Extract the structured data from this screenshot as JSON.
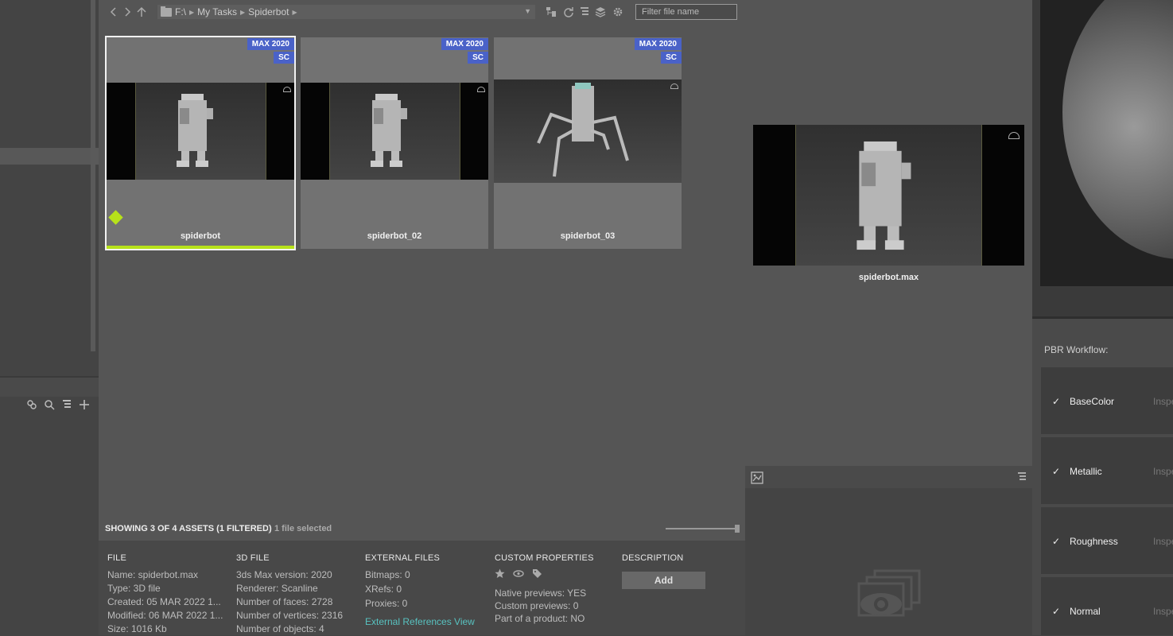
{
  "toolbar": {
    "path": [
      "F:\\",
      "My Tasks",
      "Spiderbot"
    ],
    "filter_placeholder": "Filter file name"
  },
  "assets": [
    {
      "name": "spiderbot",
      "badges": [
        "MAX 2020",
        "SC"
      ],
      "selected": true
    },
    {
      "name": "spiderbot_02",
      "badges": [
        "MAX 2020",
        "SC"
      ],
      "selected": false
    },
    {
      "name": "spiderbot_03",
      "badges": [
        "MAX 2020",
        "SC"
      ],
      "selected": false
    }
  ],
  "status": {
    "showing": "SHOWING 3 OF 4 ASSETS (1 FILTERED)",
    "selected": "1 file selected"
  },
  "info": {
    "file": {
      "header": "FILE",
      "rows": [
        "Name: spiderbot.max",
        "Type: 3D file",
        "Created: 05 MAR 2022 1...",
        "Modified: 06 MAR 2022 1...",
        "Size: 1016 Kb"
      ]
    },
    "file3d": {
      "header": "3D FILE",
      "rows": [
        "3ds Max version: 2020",
        "Renderer: Scanline",
        "Number of faces: 2728",
        "Number of vertices: 2316",
        "Number of objects: 4"
      ]
    },
    "external": {
      "header": "EXTERNAL FILES",
      "rows": [
        "Bitmaps: 0",
        "XRefs: 0",
        "Proxies: 0"
      ],
      "link": "External References View"
    },
    "custom": {
      "header": "CUSTOM PROPERTIES",
      "rows": [
        "Native previews: YES",
        "Custom previews: 0",
        "Part of a product: NO"
      ]
    },
    "description": {
      "header": "DESCRIPTION",
      "add_label": "Add"
    }
  },
  "preview": {
    "filename": "spiderbot.max"
  },
  "pbr": {
    "label": "PBR Workflow:",
    "items": [
      {
        "name": "BaseColor",
        "insp": "Inspect"
      },
      {
        "name": "Metallic",
        "insp": "Inspect"
      },
      {
        "name": "Roughness",
        "insp": "Inspect"
      },
      {
        "name": "Normal",
        "insp": "Inspect"
      }
    ]
  },
  "colors": {
    "badge": "#4a62c8",
    "accent_green": "#b7e21a",
    "link": "#58c2c0"
  }
}
